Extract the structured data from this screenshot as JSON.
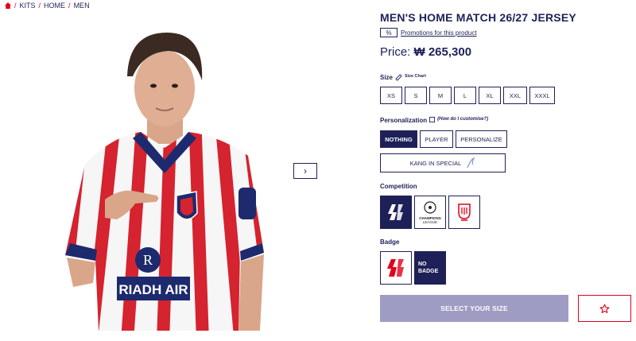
{
  "breadcrumb": {
    "items": [
      "KITS",
      "HOME",
      "MEN"
    ],
    "sep": "/"
  },
  "product": {
    "title": "MEN'S HOME MATCH 26/27 JERSEY",
    "promo_link": "Promotions for this product",
    "price_prefix": "Price:",
    "price_value": "₩ 265,300"
  },
  "size": {
    "label": "Size",
    "chart_link": "Size Chart",
    "options": [
      "XS",
      "S",
      "M",
      "L",
      "XL",
      "XXL",
      "XXXL"
    ]
  },
  "personalization": {
    "label": "Personalization",
    "help_link": "(How do I customise?)",
    "options": [
      "NOTHING",
      "PLAYER",
      "PERSONALIZE"
    ],
    "selected": "NOTHING",
    "special": "KANG IN SPECIAL"
  },
  "competition": {
    "label": "Competition",
    "options": [
      "laliga-icon",
      "champions-league-icon",
      "copa-del-rey-icon"
    ],
    "champions_text": "CHAMPIONS LEAGUE"
  },
  "badge": {
    "label": "Badge",
    "options": [
      "laliga-badge-icon",
      "no-badge"
    ],
    "no_badge_text": "NO BADGE"
  },
  "actions": {
    "cta": "SELECT YOUR SIZE",
    "wishlist_icon": "star-icon"
  },
  "colors": {
    "navy": "#1e2157",
    "red": "#e2001a",
    "cta_disabled": "#9e9cc3"
  },
  "jersey": {
    "sponsor_text": "RIADH AIR"
  }
}
